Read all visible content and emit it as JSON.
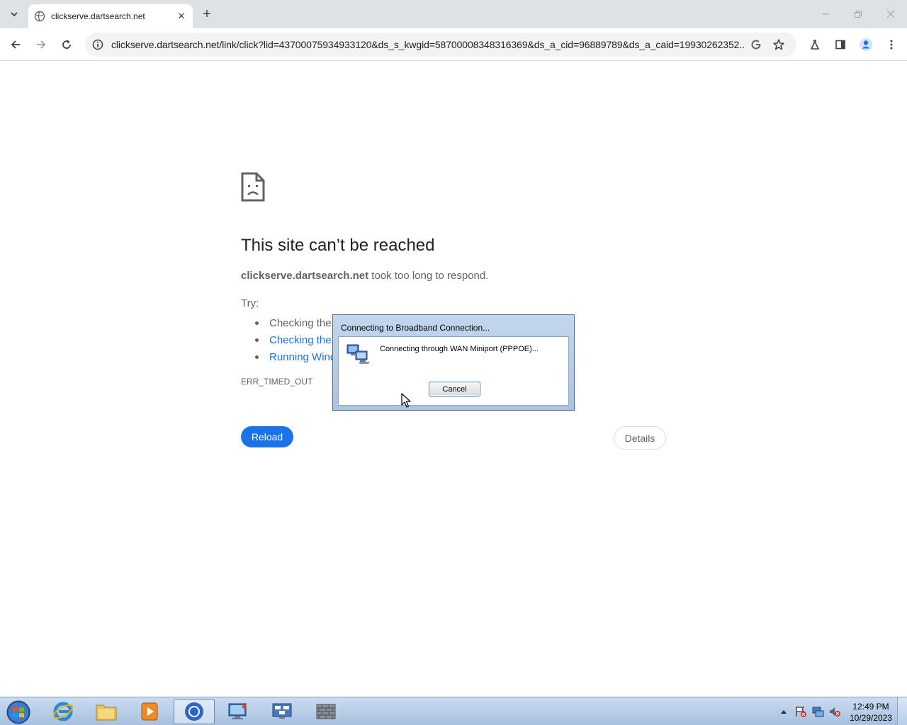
{
  "browser": {
    "tab": {
      "title": "clickserve.dartsearch.net"
    },
    "address_bar": {
      "url": "clickserve.dartsearch.net/link/click?lid=43700075934933120&ds_s_kwgid=58700008348316369&ds_a_cid=96889789&ds_a_caid=19930262352..."
    }
  },
  "error_page": {
    "title": "This site can’t be reached",
    "host": "clickserve.dartsearch.net",
    "description_suffix": " took too long to respond.",
    "try_label": "Try:",
    "suggestions": [
      {
        "text": "Checking the"
      },
      {
        "text": "Checking the"
      },
      {
        "text": "Running Wind"
      }
    ],
    "error_code": "ERR_TIMED_OUT",
    "reload_label": "Reload",
    "details_label": "Details"
  },
  "dialog": {
    "title": "Connecting to Broadband Connection...",
    "message": "Connecting through WAN Miniport (PPPOE)...",
    "cancel_label": "Cancel"
  },
  "taskbar": {
    "apps": [
      "start-orb",
      "internet-explorer",
      "windows-explorer",
      "media-player",
      "chrome",
      "remote-desktop",
      "network-connections",
      "firewall"
    ],
    "clock": {
      "time": "12:49 PM",
      "date": "10/29/2023"
    }
  },
  "colors": {
    "accent": "#1a73e8",
    "tabstrip_bg": "#dee1e6",
    "text_secondary": "#5f6368"
  }
}
